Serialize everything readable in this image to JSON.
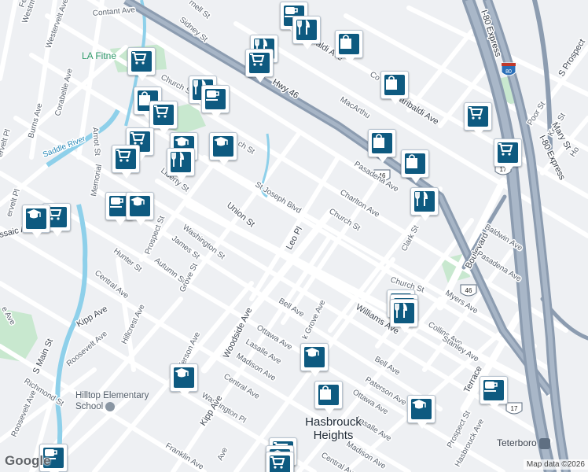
{
  "map": {
    "attribution": "Map data ©2026",
    "logo": "Google",
    "places": {
      "town_line1": "Hasbrouck",
      "town_line2": "Heights",
      "school_line1": "Hilltop Elementary",
      "school_line2": "School",
      "fitness": "LA Fitne",
      "teterboro": "Teterboro"
    },
    "highways": {
      "hwy46": "Hwy 46",
      "i80_express_1": "I-80 Express",
      "i80_express_2": "I-80 Express",
      "shield_46_a": "46",
      "shield_46_b": "46",
      "shield_17_a": "17",
      "shield_17_b": "17",
      "shield_80": "80"
    },
    "streets": {
      "contant": "Contant Ave",
      "westminster": "Westminst",
      "westervelt_top": "Westervelt Ave",
      "sidney": "Sidney St",
      "rnell": "rnell St",
      "church_nw": "Church St",
      "corabelle": "Corabelle Ave",
      "burns": "Burns Ave",
      "arnot": "Arnot St",
      "memorial": "Memorial",
      "saddle_river": "Saddle River",
      "liberty": "Liberty St",
      "ch_st": "ch St",
      "st_joseph": "St Joseph Blvd",
      "union": "Union St",
      "leo": "Leo Pl",
      "church_mid": "Church St",
      "charlton": "Charlton Ave",
      "pasadena_mid": "Pasadena Ave",
      "garibaldi": "Garibaldi Ave",
      "garibaldi_top": "baldi Ave",
      "macarthur": "MacArthu",
      "co_ave": "Co",
      "boulevard": "Boulevard",
      "baldwin": "Baldwin Ave",
      "pasadena_e": "Pasadena Ave",
      "clark": "Clark St",
      "church_e": "Church St",
      "myers": "Myers Ave",
      "collins": "Collins Ave",
      "stanley": "Stanley Ave",
      "terrace": "Terrace",
      "prospect_w": "Prospect St",
      "james": "James St",
      "washington_w": "Washington St",
      "autumn": "Autumn St",
      "grove_w": "Grove St",
      "hunter": "Hunter St",
      "central_w": "Central Ave",
      "hillcrest": "Hillcrest Ave",
      "kipp_w": "Kipp Ave",
      "roosevelt_w": "Roosevelt Ave",
      "s_main": "S Main St",
      "richmond": "Richmond St",
      "roosevelt_sw": "Roosevelt Ave",
      "passaic": "ssaic Ave",
      "woodside": "Woodside Ave",
      "bell": "Bell Ave",
      "williams": "Williams Ave",
      "ottawa": "Ottawa Ave",
      "lasalle": "Lasalle Ave",
      "madison": "Madison Ave",
      "k_grove": "k Grove Ave",
      "jefferson": "Jefferson Ave",
      "central_s": "Central Ave",
      "washington_pl": "Washington Pl",
      "kipp_s": "Kipp Ave",
      "franklin": "Franklin Ave",
      "ave_s": "Ave",
      "bell_e": "Bell Ave",
      "paterson": "Paterson Ave",
      "ottawa_e": "Ottawa Ave",
      "lasalle_e": "Lasalle Ave",
      "madison_e": "Madison Ave",
      "central_se": "Central Ave",
      "prospect_se": "Prospect St",
      "hasbrouck_ave": "Hasbrouck Ave",
      "poor": "Poor St",
      "kent": "Kent St",
      "mary": "Mary St",
      "ho": "Ho",
      "s_prospect": "S Prospect",
      "mervelt": "ervelt Pl",
      "ervelt": "ervelt Pl",
      "e_ave": "e Ave",
      "fe_ave": "Fe"
    },
    "marker_types": [
      "grocery-cart-icon",
      "restaurant-icon",
      "cafe-icon",
      "school-icon",
      "shopping-bag-icon"
    ],
    "colors": {
      "marker": "#0e5a80",
      "highway": "#8fa1b6",
      "park": "#c3e6cb",
      "water": "#8ed0ea"
    }
  }
}
